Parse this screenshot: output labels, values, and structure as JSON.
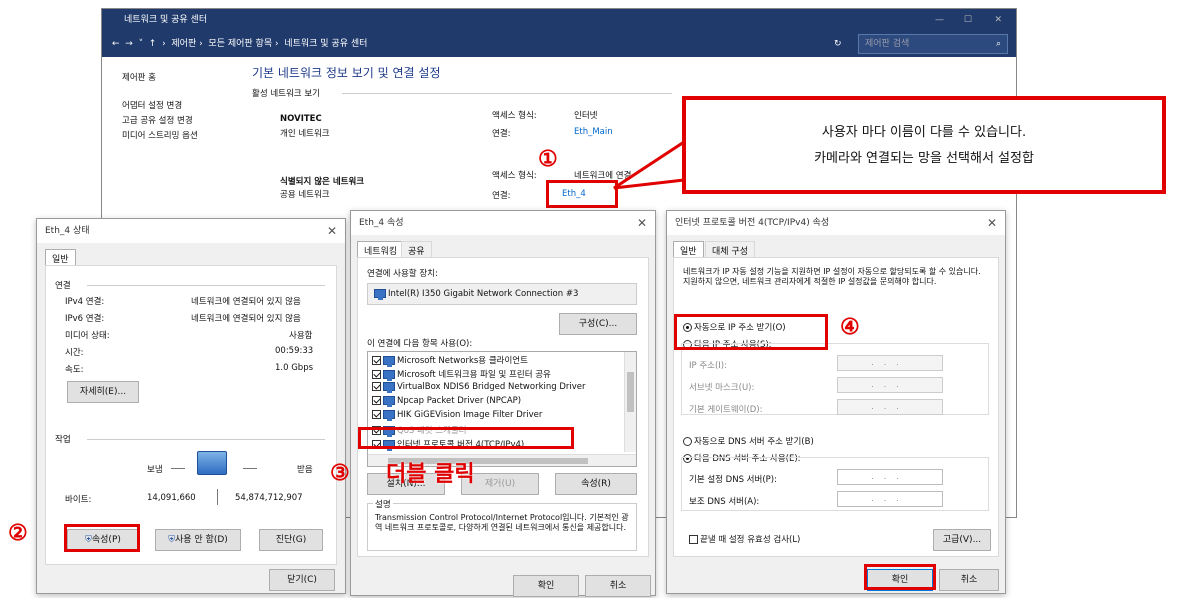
{
  "main_window": {
    "title": "네트워크 및 공유 센터",
    "breadcrumb": [
      "제어판",
      "모든 제어판 항목",
      "네트워크 및 공유 센터"
    ],
    "search_placeholder": "제어판 검색"
  },
  "sidebar": {
    "items": [
      "제어판 홈",
      "어댑터 설정 변경",
      "고급 공유 설정 변경",
      "미디어 스트리밍 옵션"
    ]
  },
  "content": {
    "heading": "기본 네트워크 정보 보기 및 연결 설정",
    "active_networks": "활성 네트워크 보기",
    "net1": {
      "name": "NOVITEC",
      "type": "개인 네트워크",
      "access_label": "액세스 형식:",
      "access_value": "인터넷",
      "conn_label": "연결:",
      "conn_value": "Eth_Main"
    },
    "net2": {
      "name": "식별되지 않은 네트워크",
      "type": "공용 네트워크",
      "access_label": "액세스 형식:",
      "access_value": "네트워크에 연결",
      "conn_label": "연결:",
      "conn_value": "Eth_4"
    }
  },
  "callout": {
    "line1": "사용자 마다 이름이 다를 수 있습니다.",
    "line2": "카메라와 연결되는 망을 선택해서 설정합"
  },
  "steps": {
    "s1": "①",
    "s2": "②",
    "s3": "③",
    "s4": "④",
    "s3_text": "더블 클릭"
  },
  "status_win": {
    "title": "Eth_4 상태",
    "tab": "일반",
    "section_conn": "연결",
    "rows": [
      {
        "k": "IPv4 연결:",
        "v": "네트워크에 연결되어 있지 않음"
      },
      {
        "k": "IPv6 연결:",
        "v": "네트워크에 연결되어 있지 않음"
      },
      {
        "k": "미디어 상태:",
        "v": "사용함"
      },
      {
        "k": "시간:",
        "v": "00:59:33"
      },
      {
        "k": "속도:",
        "v": "1.0 Gbps"
      }
    ],
    "details_btn": "자세히(E)...",
    "section_activity": "작업",
    "sent": "보냄",
    "received": "받음",
    "bytes_label": "바이트:",
    "bytes_sent": "14,091,660",
    "bytes_received": "54,874,712,907",
    "btn_props": "속성(P)",
    "btn_disable": "사용 안 함(D)",
    "btn_diag": "진단(G)",
    "btn_close": "닫기(C)"
  },
  "props_win": {
    "title": "Eth_4 속성",
    "tabs": [
      "네트워킹",
      "공유"
    ],
    "connect_using": "연결에 사용할 장치:",
    "adapter": "Intel(R) I350 Gigabit Network Connection #3",
    "configure_btn": "구성(C)...",
    "items_label": "이 연결에 다음 항목 사용(O):",
    "items": [
      "Microsoft Networks용 클라이언트",
      "Microsoft 네트워크용 파일 및 프린터 공유",
      "VirtualBox NDIS6 Bridged Networking Driver",
      "Npcap Packet Driver (NPCAP)",
      "HIK GiGEVision Image Filter Driver",
      "QoS 패킷 스케줄러",
      "인터넷 프로토콜 버전 4(TCP/IPv4)"
    ],
    "btn_install": "설치(N)...",
    "btn_remove": "제거(U)",
    "btn_props": "속성(R)",
    "desc_label": "설명",
    "desc": "Transmission Control Protocol/Internet Protocol입니다. 기본적인 광역 네트워크 프로토콜로, 다양하게 연결된 네트워크에서 통신을 제공합니다.",
    "btn_ok": "확인",
    "btn_cancel": "취소"
  },
  "ipv4_win": {
    "title": "인터넷 프로토콜 버전 4(TCP/IPv4) 속성",
    "tabs": [
      "일반",
      "대체 구성"
    ],
    "intro": "네트워크가 IP 자동 설정 기능을 지원하면 IP 설정이 자동으로 할당되도록 할 수 있습니다. 지원하지 않으면, 네트워크 관리자에게 적절한 IP 설정값을 문의해야 합니다.",
    "auto_ip": "자동으로 IP 주소 받기(O)",
    "manual_ip": "다음 IP 주소 사용(S):",
    "ip_addr": "IP 주소(I):",
    "subnet": "서브넷 마스크(U):",
    "gateway": "기본 게이트웨이(D):",
    "auto_dns": "자동으로 DNS 서버 주소 받기(B)",
    "manual_dns": "다음 DNS 서버 주소 사용(E):",
    "pref_dns": "기본 설정 DNS 서버(P):",
    "alt_dns": "보조 DNS 서버(A):",
    "validate": "끝낼 때 설정 유효성 검사(L)",
    "advanced": "고급(V)...",
    "btn_ok": "확인",
    "btn_cancel": "취소",
    "field_dots": "..."
  }
}
